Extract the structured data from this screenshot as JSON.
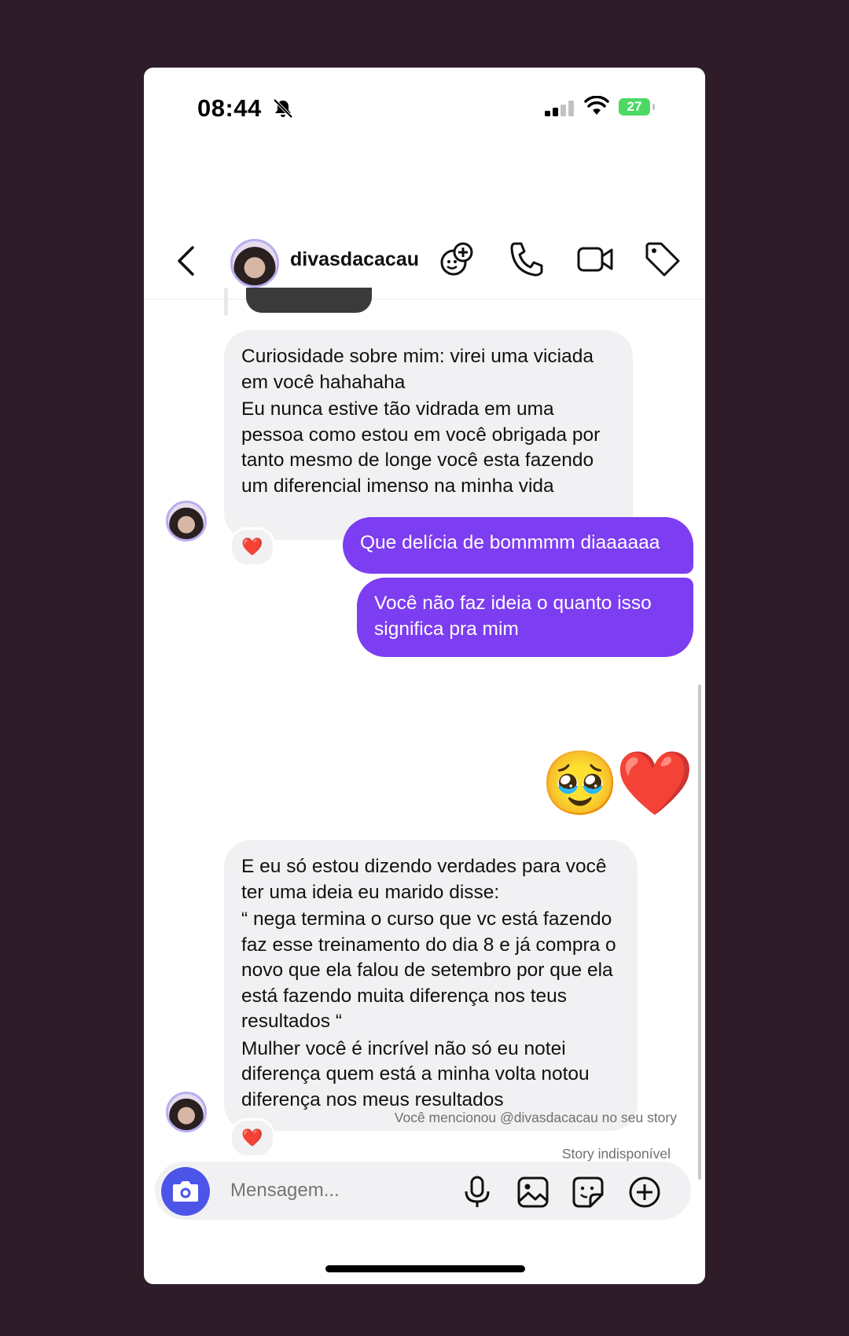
{
  "status_bar": {
    "time": "08:44",
    "battery": "27"
  },
  "header": {
    "username": "divasdacacau"
  },
  "messages": {
    "in1": {
      "lines": [
        "Curiosidade sobre mim: virei uma viciada em você hahahaha",
        "Eu nunca estive tão vidrada em uma pessoa como estou em você obrigada por tanto mesmo de longe você esta fazendo um diferencial imenso na minha vida"
      ],
      "reaction": "❤️"
    },
    "out1": "Que delícia de bommmm diaaaaaa",
    "out2": "Você não faz ideia o quanto isso significa pra mim",
    "emojis": [
      "🥹",
      "❤️"
    ],
    "in2": {
      "lines": [
        "E eu só estou dizendo verdades para você ter uma ideia eu marido disse:",
        "“ nega termina o curso que vc está fazendo faz esse treinamento do dia 8 e já compra o novo que ela falou de setembro por que ela está fazendo muita diferença nos teus resultados “",
        "Mulher você é incrível não só eu notei diferença quem está a minha volta notou diferença nos meus resultados"
      ],
      "reaction": "❤️"
    },
    "mention_note": "Você mencionou @divasdacacau no seu story",
    "story_note": "Story indisponível"
  },
  "composer": {
    "placeholder": "Mensagem..."
  },
  "colors": {
    "outgoing": "#7d3df0",
    "camera": "#4c55e8",
    "incoming": "#f1f1f3"
  }
}
